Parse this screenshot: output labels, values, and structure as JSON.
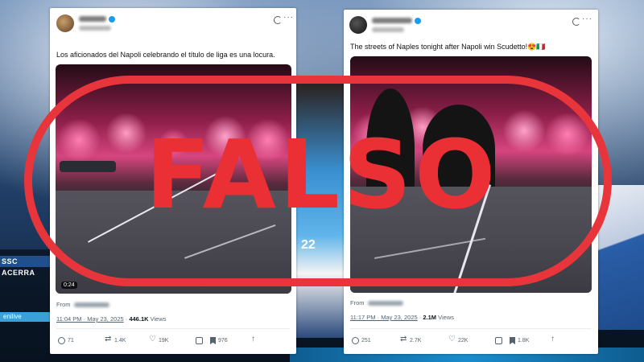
{
  "stamp": {
    "text": "FALSO",
    "color": "#e8353b"
  },
  "post_left": {
    "text": "Los aficionados del Napoli celebrando el título de liga es una locura.",
    "video_duration": "0:24",
    "from_label": "From",
    "time": "11:04 PM · May 23, 2025",
    "views_count": "446.1K",
    "views_label": "Views",
    "actions": {
      "replies": "71",
      "reposts": "1.4K",
      "likes": "19K",
      "bookmarks": "976"
    }
  },
  "post_right": {
    "text": "The streets of Naples tonight after Napoli win Scudetto!😍🇮🇹",
    "from_label": "From",
    "time": "11:17 PM · May 23, 2025",
    "views_count": "2.1M",
    "views_label": "Views",
    "actions": {
      "replies": "251",
      "reposts": "2.7K",
      "likes": "22K",
      "bookmarks": "1.8K"
    }
  },
  "background": {
    "board_text": "SSC ACERRA",
    "board_text_2": "enilive",
    "player_number": "22"
  },
  "icons": [
    "avatar",
    "verified-badge-icon",
    "grok-icon",
    "more-icon",
    "reply-icon",
    "repost-icon",
    "like-icon",
    "grok-analyze-icon",
    "bookmark-icon",
    "share-icon"
  ]
}
